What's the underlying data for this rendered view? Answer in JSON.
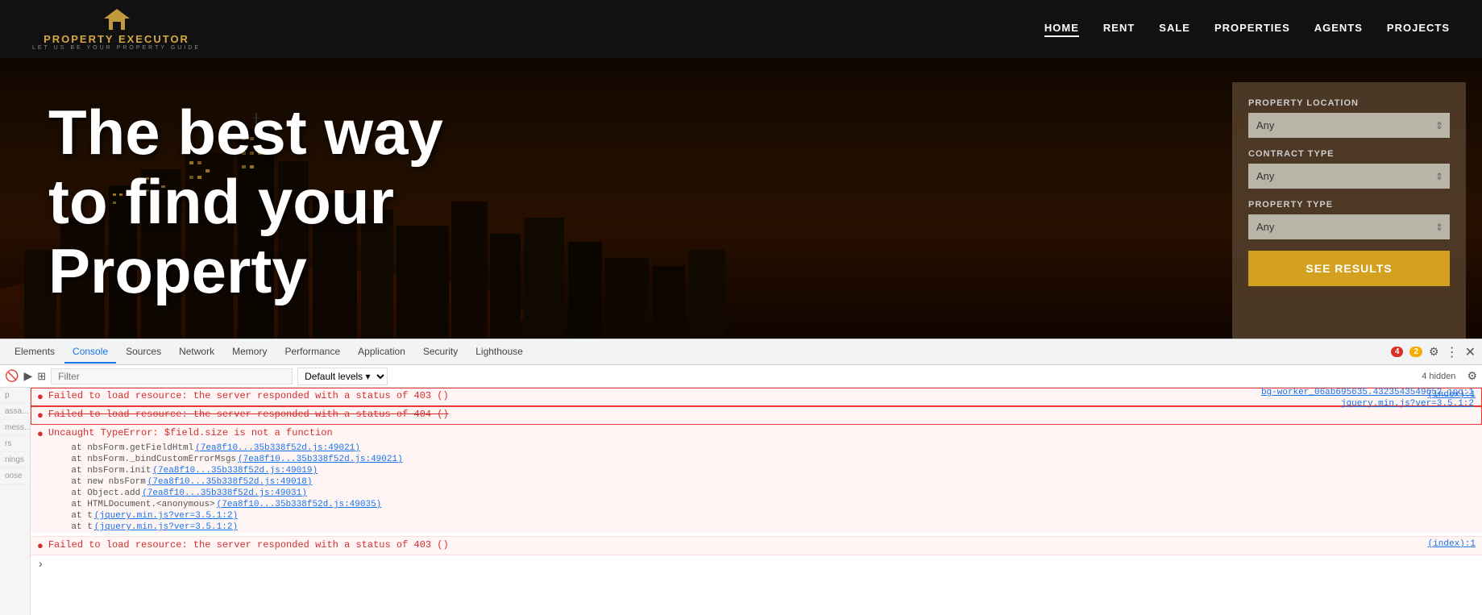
{
  "nav": {
    "logo_text": "PROPERTY EXECUTOR",
    "logo_sub": "LET US BE YOUR PROPERTY GUIDE",
    "links": [
      "HOME",
      "RENT",
      "SALE",
      "PROPERTIES",
      "AGENTS",
      "PROJECTS"
    ],
    "active_link": "HOME"
  },
  "hero": {
    "title_line1": "The best way",
    "title_line2": "to find your",
    "title_line3": "Property"
  },
  "search_panel": {
    "location_label": "PROPERTY LOCATION",
    "location_value": "Any",
    "contract_label": "CONTRACT TYPE",
    "contract_value": "Any",
    "type_label": "PROPERTY TYPE",
    "type_value": "Any",
    "button_label": "SEE RESULTS"
  },
  "devtools": {
    "tabs": [
      "Elements",
      "Console",
      "Sources",
      "Network",
      "Memory",
      "Performance",
      "Application",
      "Security",
      "Lighthouse"
    ],
    "active_tab": "Console",
    "badge_red": "4",
    "badge_yellow": "2",
    "hidden_count": "4 hidden",
    "filter_placeholder": "Filter",
    "default_levels": "Default levels ▾",
    "console_lines": [
      {
        "type": "error",
        "circled": true,
        "text": "Failed to load resource: the server responded with a status of 403 ()",
        "location": "(index):1"
      },
      {
        "type": "error",
        "circled": true,
        "strikethrough": true,
        "text": "Failed to load resource: the server responded with a status of 404 ()",
        "location": ""
      },
      {
        "type": "error",
        "circled": false,
        "text": "Uncaught TypeError: $field.size is not a function",
        "location": ""
      }
    ],
    "stack_trace": [
      {
        "text": "at nbsForm.getFieldHtml",
        "link": "(7ea8f10...35b338f52d.js:49021)"
      },
      {
        "text": "at nbsForm._bindCustomErrorMsgs",
        "link": "(7ea8f10...35b338f52d.js:49021)"
      },
      {
        "text": "at nbsForm.init",
        "link": "(7ea8f10...35b338f52d.js:49019)"
      },
      {
        "text": "at new nbsForm",
        "link": "(7ea8f10...35b338f52d.js:49018)"
      },
      {
        "text": "at Object.add",
        "link": "(7ea8f10...35b338f52d.js:49031)"
      },
      {
        "text": "at HTMLDocument.<anonymous>",
        "link": "(7ea8f10...35b338f52d.js:49035)"
      },
      {
        "text": "at t",
        "link": "(jquery.min.js?ver=3.5.1:2)"
      },
      {
        "text": "at t",
        "link": "(jquery.min.js?ver=3.5.1:2)"
      }
    ],
    "bottom_error": "Failed to load resource: the server responded with a status of 403 ()",
    "bottom_error_location": "(index):1",
    "right_sources": [
      "bg-worker_06ab695635.4323543549652.jpg:1",
      "jquery.min.js?ver=3.5.1:2"
    ]
  }
}
